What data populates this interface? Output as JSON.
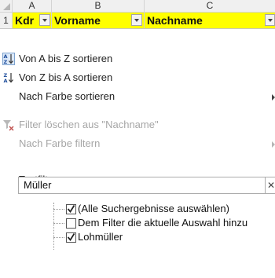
{
  "sheet": {
    "columns": [
      {
        "letter": "A"
      },
      {
        "letter": "B"
      },
      {
        "letter": "C"
      }
    ],
    "row_number": "1",
    "header_cells": [
      "Kdr",
      "Vorname",
      "Nachname"
    ]
  },
  "menu": {
    "sort_asc": "Von A bis Z sortieren",
    "sort_desc": "Von Z bis A sortieren",
    "sort_by_color": "Nach Farbe sortieren",
    "clear_filter": "Filter löschen aus \"Nachname\"",
    "filter_by_color": "Nach Farbe filtern",
    "text_filter": "Textfilter"
  },
  "search": {
    "value": "Müller",
    "clear_icon": "close-icon"
  },
  "results": {
    "items": [
      {
        "label": "(Alle Suchergebnisse auswählen)",
        "checked": true
      },
      {
        "label": "Dem Filter die aktuelle Auswahl hinzu",
        "checked": false
      },
      {
        "label": "Lohmüller",
        "checked": true
      }
    ]
  },
  "icons": {
    "sort_asc": "sort-ascending-icon",
    "sort_desc": "sort-descending-icon",
    "clear_filter": "clear-filter-icon"
  },
  "colors": {
    "header_highlight": "#ffff00",
    "disabled_text": "#a6a6a6"
  }
}
